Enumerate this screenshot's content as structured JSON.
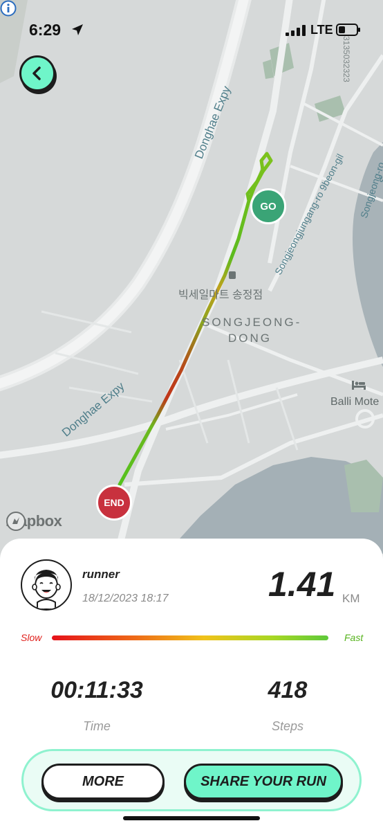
{
  "status_bar": {
    "time": "6:29",
    "network": "LTE"
  },
  "map": {
    "road_labels": [
      "Donghae Expy",
      "Songjeongjungang-ro 9beon-gil",
      "Songjeongjungang-ro",
      "Songjeong-ro",
      "Donghae Expy"
    ],
    "place_labels": [
      "빅세일마트 송정점",
      "SONGJEONG-",
      "DONG",
      "Balli Mote"
    ],
    "map_id": "3135032323",
    "start_marker": "GO",
    "end_marker": "END",
    "attribution": "mapbox"
  },
  "summary": {
    "user_name": "runner",
    "date": "18/12/2023 18:17",
    "distance": "1.41",
    "distance_unit": "KM"
  },
  "speed_legend": {
    "slow": "Slow",
    "fast": "Fast"
  },
  "stats": [
    {
      "value": "00:11:33",
      "label": "Time"
    },
    {
      "value": "418",
      "label": "Steps"
    }
  ],
  "actions": {
    "more": "MORE",
    "share": "SHARE YOUR RUN"
  },
  "colors": {
    "accent": "#6ff5c9",
    "start": "#3aa476",
    "end": "#c8313e",
    "slow": "#e0201c",
    "fast": "#55b31c"
  }
}
